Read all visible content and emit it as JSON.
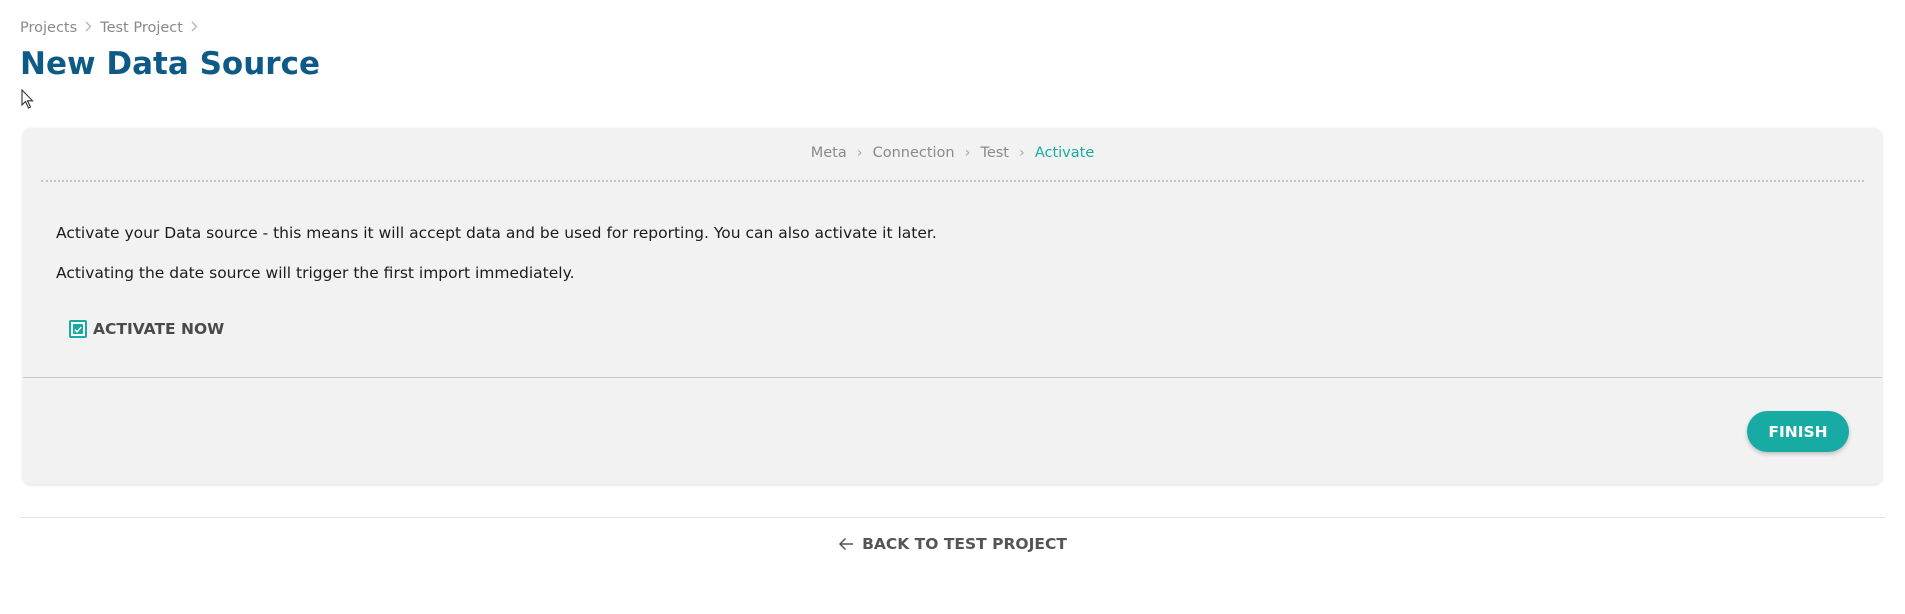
{
  "breadcrumb": {
    "items": [
      {
        "label": "Projects"
      },
      {
        "label": "Test Project"
      }
    ],
    "separator_icon": "chevron-right-icon"
  },
  "page": {
    "title": "New Data Source"
  },
  "wizard": {
    "steps": [
      {
        "label": "Meta",
        "active": false
      },
      {
        "label": "Connection",
        "active": false
      },
      {
        "label": "Test",
        "active": false
      },
      {
        "label": "Activate",
        "active": true
      }
    ],
    "step_separator": "›",
    "description": [
      "Activate your Data source - this means it will accept data and be used for reporting. You can also activate it later.",
      "Activating the date source will trigger the first import immediately."
    ],
    "activate_checkbox": {
      "label": "ACTIVATE NOW",
      "checked": true
    },
    "finish_label": "FINISH"
  },
  "footer": {
    "back_label": "BACK TO TEST PROJECT",
    "back_icon": "arrow-left-icon"
  },
  "colors": {
    "title": "#0d5a86",
    "accent": "#17aba4",
    "card_background": "#f2f2f2"
  }
}
